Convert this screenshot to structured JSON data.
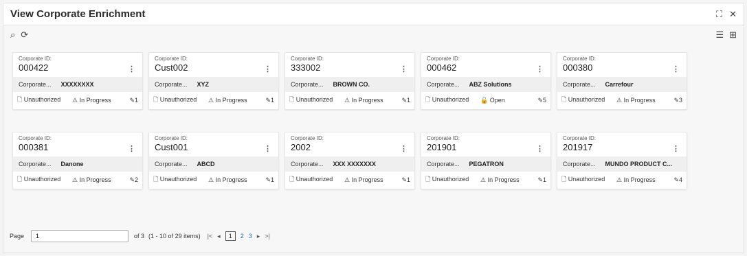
{
  "window": {
    "title": "View Corporate Enrichment"
  },
  "toolbar": {
    "search_icon": "⌕",
    "refresh_icon": "⟳"
  },
  "cards": [
    {
      "label": "Corporate ID:",
      "id": "000422",
      "name_label": "Corporate...",
      "name": "XXXXXXXX",
      "status": "Unauthorized",
      "state": "In Progress",
      "count": "1",
      "state_icon": "⚠"
    },
    {
      "label": "Corporate ID:",
      "id": "Cust002",
      "name_label": "Corporate...",
      "name": "XYZ",
      "status": "Unauthorized",
      "state": "In Progress",
      "count": "1",
      "state_icon": "⚠"
    },
    {
      "label": "Corporate ID:",
      "id": "333002",
      "name_label": "Corporate...",
      "name": "BROWN CO.",
      "status": "Unauthorized",
      "state": "In Progress",
      "count": "1",
      "state_icon": "⚠"
    },
    {
      "label": "Corporate ID:",
      "id": "000462",
      "name_label": "Corporate...",
      "name": "ABZ Solutions",
      "status": "Unauthorized",
      "state": "Open",
      "count": "5",
      "state_icon": "🔓"
    },
    {
      "label": "Corporate ID:",
      "id": "000380",
      "name_label": "Corporate...",
      "name": "Carrefour",
      "status": "Unauthorized",
      "state": "In Progress",
      "count": "3",
      "state_icon": "⚠"
    },
    {
      "label": "Corporate ID:",
      "id": "000381",
      "name_label": "Corporate...",
      "name": "Danone",
      "status": "Unauthorized",
      "state": "In Progress",
      "count": "2",
      "state_icon": "⚠"
    },
    {
      "label": "Corporate ID:",
      "id": "Cust001",
      "name_label": "Corporate...",
      "name": "ABCD",
      "status": "Unauthorized",
      "state": "In Progress",
      "count": "1",
      "state_icon": "⚠"
    },
    {
      "label": "Corporate ID:",
      "id": "2002",
      "name_label": "Corporate...",
      "name": "XXX XXXXXXX",
      "status": "Unauthorized",
      "state": "In Progress",
      "count": "1",
      "state_icon": "⚠"
    },
    {
      "label": "Corporate ID:",
      "id": "201901",
      "name_label": "Corporate...",
      "name": "PEGATRON",
      "status": "Unauthorized",
      "state": "In Progress",
      "count": "1",
      "state_icon": "⚠"
    },
    {
      "label": "Corporate ID:",
      "id": "201917",
      "name_label": "Corporate...",
      "name": "MUNDO PRODUCT C...",
      "status": "Unauthorized",
      "state": "In Progress",
      "count": "4",
      "state_icon": "⚠"
    }
  ],
  "pager": {
    "page_label": "Page",
    "page_value": "1",
    "of_text": "of 3",
    "items_text": "(1 - 10 of 29 items)",
    "pages": [
      "1",
      "2",
      "3"
    ]
  }
}
